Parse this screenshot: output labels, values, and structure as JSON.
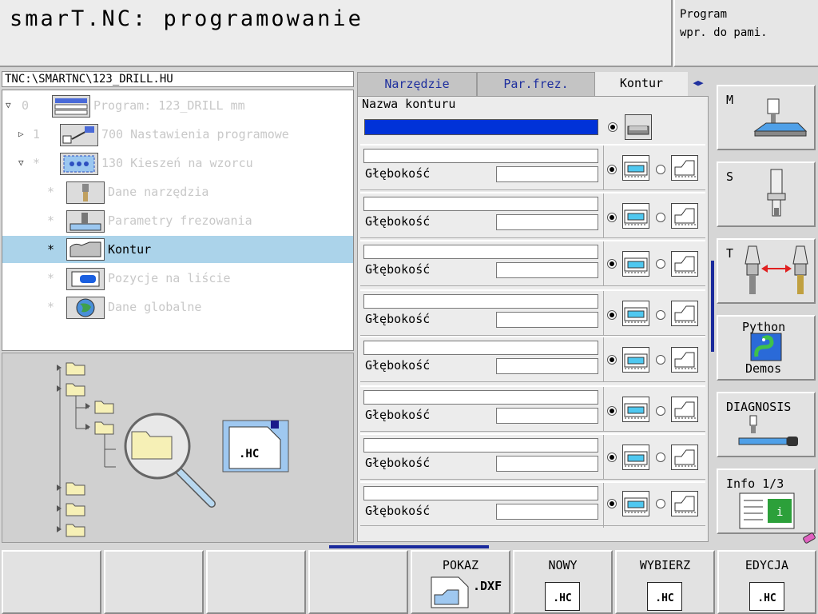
{
  "header": {
    "title": "smarT.NC: programowanie",
    "program_line1": "Program",
    "program_line2": "wpr. do pami."
  },
  "tree": {
    "path": "TNC:\\SMARTNC\\123_DRILL.HU",
    "items": [
      {
        "arrow": "▽",
        "num": "0",
        "label": "Program: 123_DRILL mm"
      },
      {
        "arrow": "▷",
        "num": "1",
        "label": "700 Nastawienia programowe"
      },
      {
        "arrow": "▽",
        "num": "*",
        "label": "130 Kieszeń na wzorcu"
      },
      {
        "arrow": "",
        "num": "*",
        "label": "Dane narzędzia"
      },
      {
        "arrow": "",
        "num": "*",
        "label": "Parametry frezowania"
      },
      {
        "arrow": "",
        "num": "*",
        "label": "Kontur"
      },
      {
        "arrow": "",
        "num": "*",
        "label": "Pozycje na liście"
      },
      {
        "arrow": "",
        "num": "*",
        "label": "Dane globalne"
      }
    ]
  },
  "preview": {
    "file_label": ".HC"
  },
  "tabs": [
    {
      "label": "Narzędzie"
    },
    {
      "label": "Par.frez."
    },
    {
      "label": "Kontur"
    }
  ],
  "form": {
    "name_label": "Nazwa konturu",
    "rows": [
      {
        "label": "Głębokość"
      },
      {
        "label": "Głębokość"
      },
      {
        "label": "Głębokość"
      },
      {
        "label": "Głębokość"
      },
      {
        "label": "Głębokość"
      },
      {
        "label": "Głębokość"
      },
      {
        "label": "Głębokość"
      },
      {
        "label": "Głębokość"
      }
    ]
  },
  "right_keys": [
    {
      "label": "M"
    },
    {
      "label": "S"
    },
    {
      "label": "T"
    },
    {
      "label": "Python",
      "label2": "Demos"
    },
    {
      "label": "DIAGNOSIS"
    },
    {
      "label": "Info 1/3"
    }
  ],
  "bottom_keys": [
    {
      "label": "POKAZ",
      "sub": ".DXF"
    },
    {
      "label": "NOWY",
      "sub": ".HC"
    },
    {
      "label": "WYBIERZ",
      "sub": ".HC"
    },
    {
      "label": "EDYCJA",
      "sub": ".HC"
    }
  ],
  "colors": {
    "selection": "#abd3ea",
    "accent_blue": "#1e2f9e",
    "input_active": "#0032d8"
  }
}
